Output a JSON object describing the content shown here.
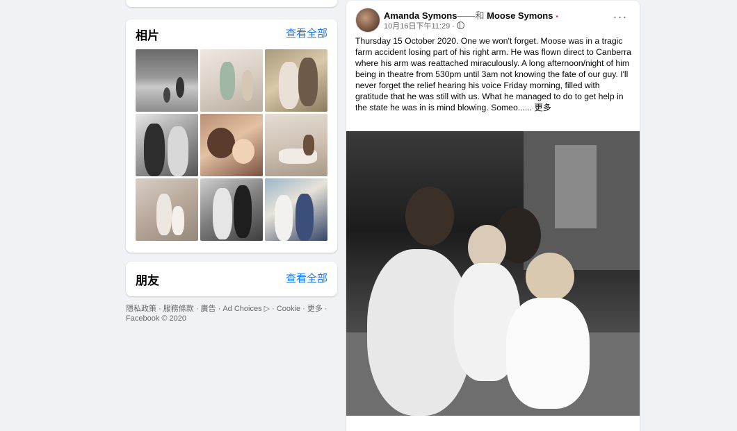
{
  "photos": {
    "title": "相片",
    "see_all": "查看全部"
  },
  "friends": {
    "title": "朋友",
    "see_all": "查看全部"
  },
  "footer": {
    "line1": "隱私政策 · 服務條款 · 廣告 · Ad Choices ▷ · Cookie · 更多 ·",
    "line2": "Facebook © 2020"
  },
  "post": {
    "author": "Amanda Symons",
    "with_text": "——和",
    "tagged": "Moose Symons",
    "timestamp": "10月16日下午11:29 ·",
    "more_label": "···",
    "text": "Thursday 15 October 2020. One we won't forget. Moose was in a tragic farm accident losing part of his right arm. He was flown direct to Canberra where his arm was reattached miraculously. A long afternoon/night of him being in theatre from 530pm until 3am not knowing the fate of our guy. I'll never forget the relief hearing his voice Friday morning, filled with gratitude that he was still with us. What he managed to do to get help in the state he was in is mind blowing. Someo......",
    "see_more": "更多"
  },
  "colors": {
    "link": "#1877f2",
    "background": "#f0f2f5",
    "secondary_text": "#65676b"
  }
}
